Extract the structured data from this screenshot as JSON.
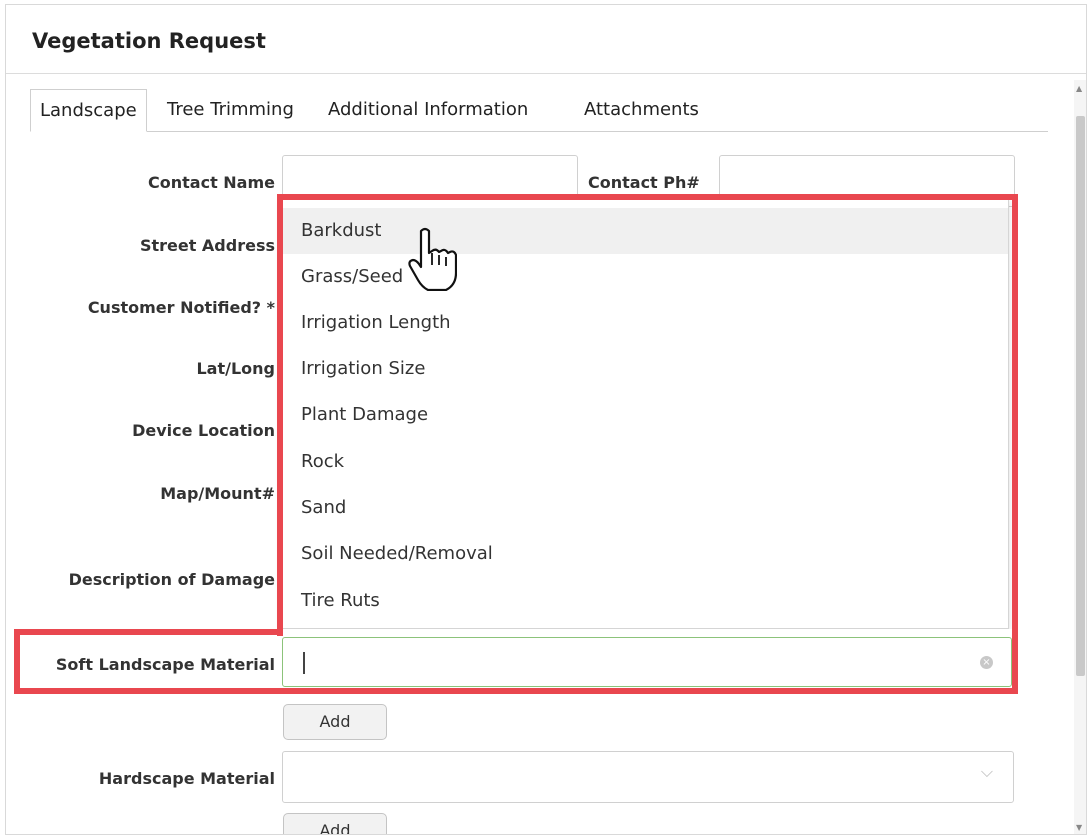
{
  "window": {
    "title": "Vegetation Request"
  },
  "tabs": [
    {
      "label": "Landscape",
      "active": true
    },
    {
      "label": "Tree Trimming",
      "active": false
    },
    {
      "label": "Additional Information",
      "active": false
    },
    {
      "label": "Attachments",
      "active": false
    }
  ],
  "form": {
    "contact_name_label": "Contact Name",
    "contact_phone_label": "Contact Ph#",
    "street_address_label": "Street Address",
    "customer_notified_label": "Customer Notified? *",
    "lat_long_label": "Lat/Long",
    "device_location_label": "Device Location",
    "map_mount_label": "Map/Mount#",
    "description_label": "Description of Damage",
    "soft_landscape_label": "Soft Landscape Material",
    "soft_landscape_value": "",
    "add_label": "Add",
    "hardscape_label": "Hardscape Material",
    "hardscape_value": "",
    "add2_label": "Add"
  },
  "dropdown": {
    "options": [
      "Barkdust",
      "Grass/Seed",
      "Irrigation Length",
      "Irrigation Size",
      "Plant Damage",
      "Rock",
      "Sand",
      "Soil Needed/Removal",
      "Tire Ruts"
    ],
    "hovered": "Barkdust"
  },
  "colors": {
    "highlight": "#e9474f",
    "active_field_border": "#8cc37a"
  },
  "icons": {
    "clear": "clear-circle-icon",
    "chevron": "chevron-down-icon",
    "cursor": "hand-pointer-icon"
  }
}
